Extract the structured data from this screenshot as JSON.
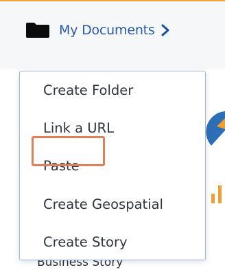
{
  "colors": {
    "accent_top_rule": "#f3a33b",
    "panel_bg": "#f6f7f9",
    "breadcrumb_text": "#2a5aa8",
    "chevron": "#1f4f9c",
    "folder_icon": "#0b0b0b",
    "menu_border": "#9fb6d6",
    "menu_text": "#2f3540",
    "highlight": "#e0805b",
    "pie_blue": "#2d6fb6",
    "pie_orange": "#f0a032",
    "bar_orange": "#f0a032"
  },
  "breadcrumb": {
    "icon": "folder-icon",
    "label": "My Documents",
    "chevron_icon": "chevron-right-icon"
  },
  "context_menu": {
    "items": [
      {
        "label": "Create Folder"
      },
      {
        "label": "Link a URL"
      },
      {
        "label": "Paste",
        "highlighted": true
      },
      {
        "label": "Create Geospatial"
      },
      {
        "label": "Create Story"
      }
    ]
  },
  "background_card": {
    "label": "Business Story"
  }
}
